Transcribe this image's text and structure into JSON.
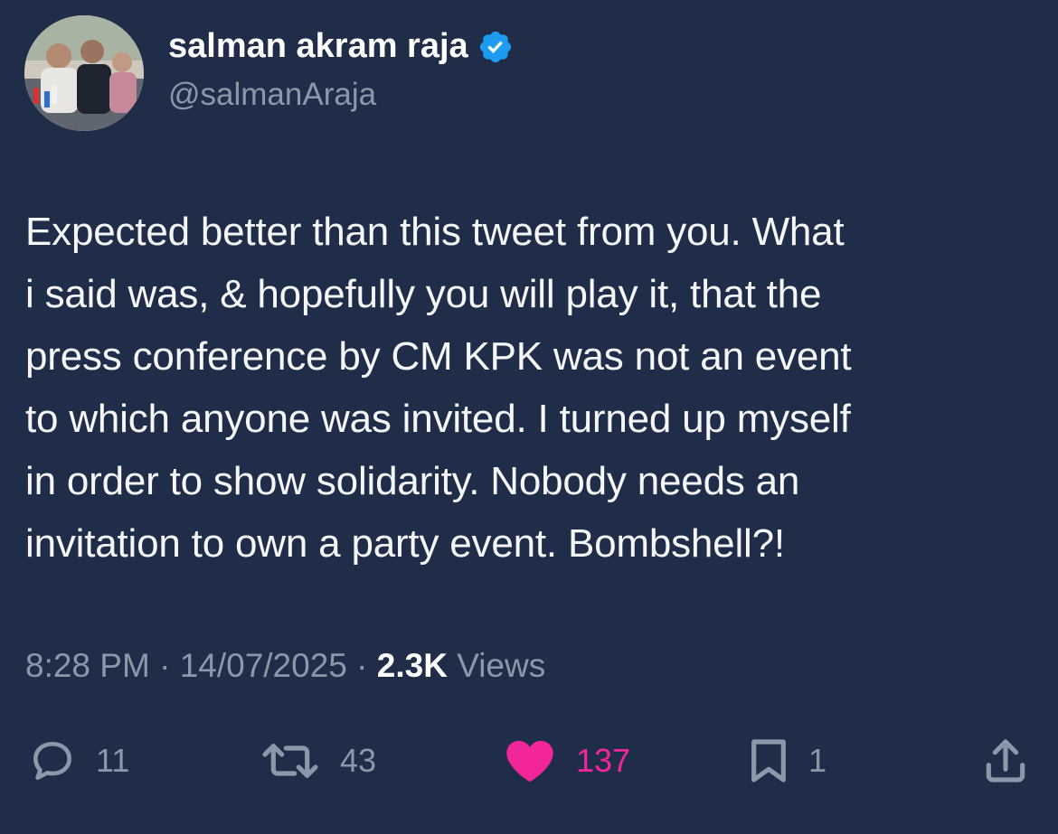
{
  "tweet": {
    "author": {
      "display_name": "salman akram raja",
      "handle": "@salmanAraja",
      "verified": true
    },
    "text_lines": [
      "Expected better than this tweet from you. What",
      "i said was, & hopefully you will play it, that the",
      "press conference by CM KPK was not an event",
      "to which anyone was invited. I turned up myself",
      "in order to show solidarity. Nobody needs an",
      "invitation to own a party event. Bombshell?!"
    ],
    "meta": {
      "time": "8:28 PM",
      "separator": "·",
      "date": "14/07/2025",
      "views_count": "2.3K",
      "views_label": "Views"
    },
    "actions": {
      "replies": "11",
      "reposts": "43",
      "likes": "137",
      "bookmarks": "1"
    }
  },
  "colors": {
    "background": "#202d48",
    "text": "#f5f6f8",
    "muted": "#8b98a9",
    "verified": "#1d9bf0",
    "like": "#f2259a"
  },
  "icons": {
    "reply": "speech-bubble-icon",
    "repost": "repost-arrows-icon",
    "like": "heart-filled-icon",
    "bookmark": "bookmark-icon",
    "share": "share-upload-icon",
    "verified": "verified-badge-icon"
  }
}
